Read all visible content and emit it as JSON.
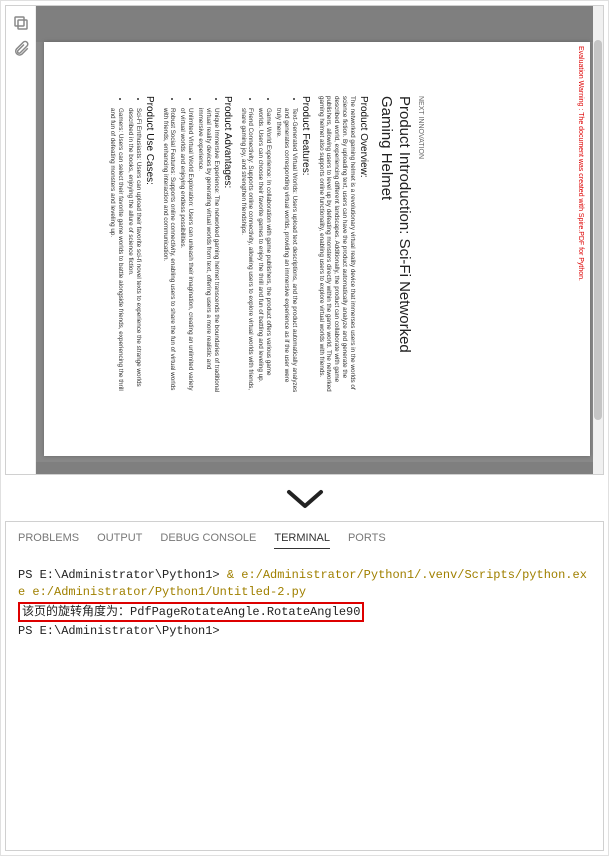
{
  "pdf": {
    "watermark": "Evaluation Warning : The document was created with Spire.PDF for Python.",
    "header": "NEXT INNOVATION",
    "title": "Product Introduction: Sci-Fi Networked Gaming Helmet",
    "overview_h": "Product Overview:",
    "overview_p": "The networked gaming helmet is a revolutionary virtual reality device that immerses users in the worlds of science fiction. By uploading text, users can have the product automatically analyze and generate the described world, experiencing different landscapes. Additionally, the product can collaborate with game publishers, allowing users to level up by defeating monsters directly within the game world. The networked gaming helmet also supports online functionality, enabling users to explore virtual worlds with friends.",
    "features_h": "Product Features:",
    "features": [
      "Text-Generated Virtual Worlds: Users upload text descriptions, and the product automatically analyzes and generates corresponding virtual worlds, providing an immersive experience as if the user were truly there.",
      "Game World Experience: In collaboration with game publishers, the product offers various game worlds. Users can choose their favorite games to enjoy the thrill and fun of battling and leveling up.",
      "Friend Connectivity: Supports online connectivity, allowing users to explore virtual worlds with friends, share gaming joy, and strengthen friendships."
    ],
    "advantages_h": "Product Advantages:",
    "advantages": [
      "Unique Immersive Experience: The networked gaming helmet transcends the boundaries of traditional virtual reality devices by generating virtual worlds from text, offering users a more realistic and immersive experience.",
      "Unlimited Virtual World Exploration: Users can unleash their imagination, creating an unlimited variety of virtual worlds and enjoying endless possibilities.",
      "Robust Social Features: Supports online connectivity, enabling users to share the fun of virtual worlds with friends, enhancing interaction and communication."
    ],
    "usecases_h": "Product Use Cases:",
    "usecases": [
      "Sci-Fi Enthusiasts: Users can upload their favorite sci-fi novel texts to experience the strange worlds described in the books, enjoying the allure of science fiction.",
      "Gamers: Users can select their favorite game worlds to battle alongside friends, experiencing the thrill and fun of defeating monsters and leveling up."
    ]
  },
  "tabs": {
    "problems": "PROBLEMS",
    "output": "OUTPUT",
    "debug": "DEBUG CONSOLE",
    "terminal": "TERMINAL",
    "ports": "PORTS"
  },
  "terminal": {
    "line1_prompt": "PS E:\\Administrator\\Python1> ",
    "line1_cmd": "& e:/Administrator/Python1/.venv/Scripts/python.exe e:/Administrator/Python1/Untitled-2.py",
    "line2": "该页的旋转角度为：PdfPageRotateAngle.RotateAngle90",
    "line3_prompt": "PS E:\\Administrator\\Python1> "
  }
}
